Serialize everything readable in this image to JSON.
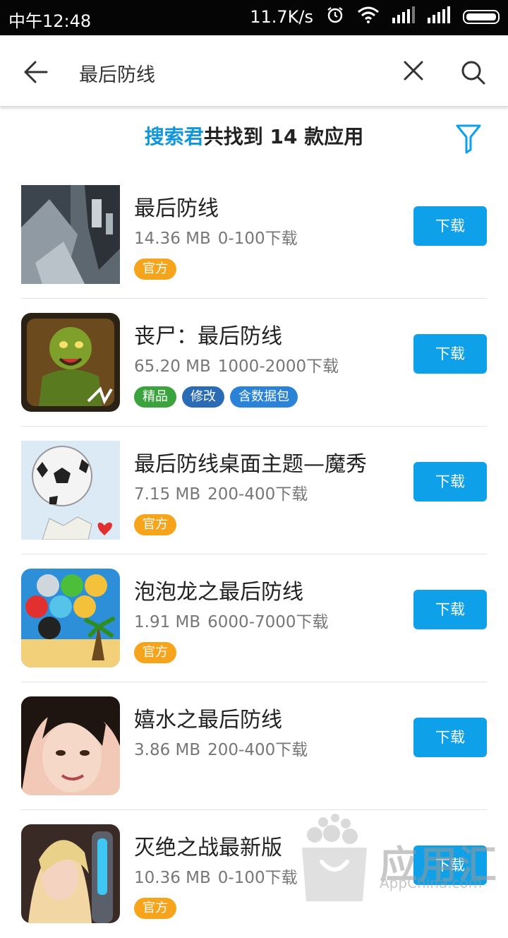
{
  "status_bar": {
    "time": "中午12:48",
    "speed": "11.7K/s"
  },
  "search": {
    "query": "最后防线"
  },
  "summary": {
    "brand": "搜索君",
    "text": "共找到 14 款应用"
  },
  "download_label": "下载",
  "apps": [
    {
      "name": "最后防线",
      "size": "14.36 MB",
      "downloads": "0-100下载",
      "tags": [
        "官方"
      ]
    },
    {
      "name": "丧尸：最后防线",
      "size": "65.20 MB",
      "downloads": "1000-2000下载",
      "tags": [
        "精品",
        "修改",
        "含数据包"
      ]
    },
    {
      "name": "最后防线桌面主题—魔秀",
      "size": "7.15 MB",
      "downloads": "200-400下载",
      "tags": [
        "官方"
      ]
    },
    {
      "name": "泡泡龙之最后防线",
      "size": "1.91 MB",
      "downloads": "6000-7000下载",
      "tags": [
        "官方"
      ]
    },
    {
      "name": "嬉水之最后防线",
      "size": "3.86 MB",
      "downloads": "200-400下载",
      "tags": []
    },
    {
      "name": "灭绝之战最新版",
      "size": "10.36 MB",
      "downloads": "0-100下载",
      "tags": [
        "官方"
      ]
    }
  ],
  "watermark": {
    "title": "应用汇",
    "subtitle": "AppChina.com"
  },
  "colors": {
    "accent": "#0ea0e8",
    "brand_text": "#1296db",
    "official_tag": "#f5a41c",
    "quality_tag": "#3aa33e",
    "mod_tag": "#2a6bb5",
    "data_tag": "#2a83d6"
  },
  "icons": [
    "back-arrow-icon",
    "clear-icon",
    "search-icon",
    "filter-icon",
    "alarm-icon",
    "wifi-icon",
    "signal-icon",
    "battery-icon"
  ]
}
